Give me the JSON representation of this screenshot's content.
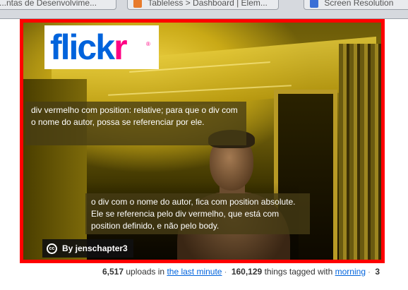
{
  "browser": {
    "tabs": [
      {
        "label": "...ntas de Desenvolvime..."
      },
      {
        "label": "Tableless > Dashboard | Elem..."
      },
      {
        "label": "Screen Resolution"
      }
    ]
  },
  "logo": {
    "text_blue": "flick",
    "text_pink": "r",
    "mark": "®"
  },
  "notes": {
    "relative": "div vermelho com position: relative; para que o div com o nome do autor, possa se  referenciar por ele.",
    "absolute": "o div com o nome do autor, fica com position absolute. Ele se referencia pelo div vermelho, que está com position definido, e não pelo body."
  },
  "author": {
    "cc_icon": "cc",
    "label": "By jenschapter3"
  },
  "stats": {
    "uploads_count": "6,517",
    "uploads_text": "uploads in",
    "uploads_link": "the last minute",
    "tagged_count": "160,129",
    "tagged_text": "things tagged with",
    "tagged_link": "morning",
    "sep": "·",
    "tail": "3"
  },
  "colors": {
    "frame": "#ff0000",
    "flickr_blue": "#0063dc",
    "flickr_pink": "#ff0084"
  }
}
